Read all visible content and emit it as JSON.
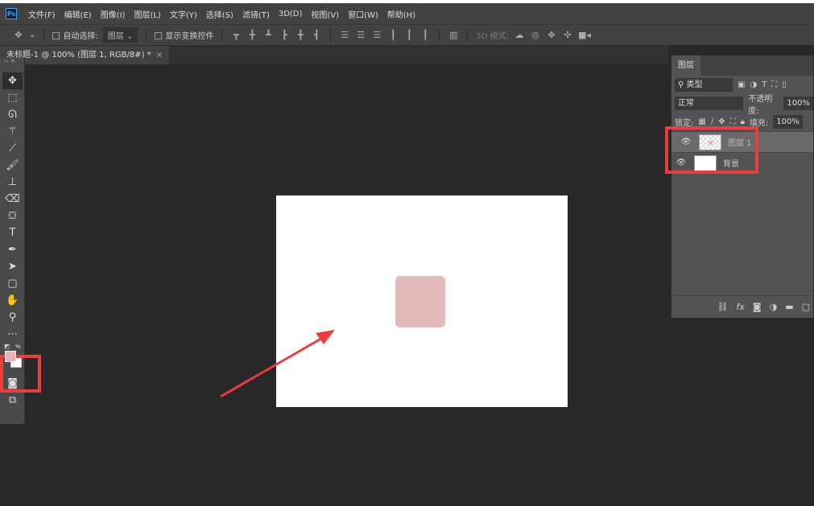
{
  "app": {
    "logo": "Ps"
  },
  "menu": [
    "文件(F)",
    "编辑(E)",
    "图像(I)",
    "图层(L)",
    "文字(Y)",
    "选择(S)",
    "滤镜(T)",
    "3D(D)",
    "视图(V)",
    "窗口(W)",
    "帮助(H)"
  ],
  "options": {
    "auto_select": "自动选择:",
    "auto_select_target": "图层",
    "show_transform": "显示变换控件",
    "mode_3d": "3D 模式:"
  },
  "document_tab": {
    "title": "未标题-1 @ 100% (图层 1, RGB/8#) *",
    "close": "×"
  },
  "tools": [
    "move",
    "marquee",
    "lasso",
    "magic-wand",
    "eyedropper",
    "brush",
    "stamp",
    "eraser",
    "paint-bucket",
    "type",
    "pen",
    "path-select",
    "shape",
    "hand",
    "zoom",
    "more"
  ],
  "colors": {
    "foreground": "#e8b4b6",
    "background": "#ffffff",
    "shape": "#e3b9b9",
    "highlight": "#ec3c3c"
  },
  "layers_panel": {
    "tab": "图层",
    "filter_kind": "类型",
    "blend_mode": "正常",
    "opacity_label": "不透明度:",
    "opacity": "100%",
    "lock_label": "锁定:",
    "fill_label": "填充:",
    "fill": "100%",
    "layers": [
      {
        "name": "图层 1",
        "selected": true
      },
      {
        "name": "背景",
        "selected": false
      }
    ]
  }
}
